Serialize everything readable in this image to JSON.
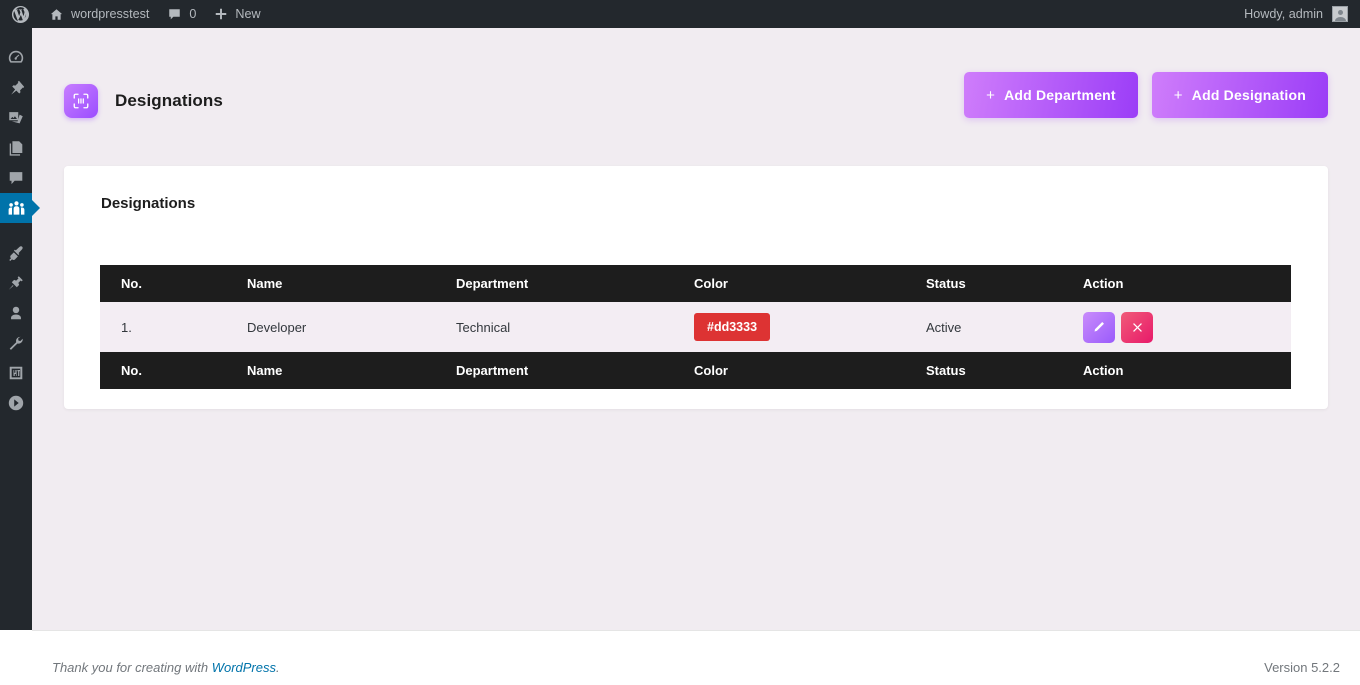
{
  "adminbar": {
    "logo_icon": "wordpress-logo-icon",
    "site_name": "wordpresstest",
    "home_icon": "home-icon",
    "comments_icon": "comment-bubble-icon",
    "comment_count": "0",
    "new_icon": "plus-icon",
    "new_label": "New",
    "howdy": "Howdy, admin",
    "avatar_icon": "avatar-icon"
  },
  "sidebar": {
    "items": [
      {
        "icon": "dashboard-gauge-icon",
        "active": false
      },
      {
        "icon": "pin-posts-icon",
        "active": false
      },
      {
        "icon": "media-photo-icon",
        "active": false
      },
      {
        "icon": "pages-document-icon",
        "active": false
      },
      {
        "icon": "comments-bubble-icon",
        "active": false
      },
      {
        "icon": "group-people-icon",
        "active": true
      },
      {
        "icon": "appearance-brush-icon",
        "active": false
      },
      {
        "icon": "plugins-plug-icon",
        "active": false
      },
      {
        "icon": "users-person-icon",
        "active": false
      },
      {
        "icon": "tools-wrench-icon",
        "active": false
      },
      {
        "icon": "settings-sliders-icon",
        "active": false
      },
      {
        "icon": "collapse-arrow-icon",
        "active": false
      }
    ]
  },
  "page": {
    "icon": "designation-badge-icon",
    "title": "Designations",
    "buttons": [
      {
        "icon": "plus-icon",
        "label": "Add Department"
      },
      {
        "icon": "plus-icon",
        "label": "Add Designation"
      }
    ]
  },
  "card": {
    "title": "Designations",
    "columns": [
      "No.",
      "Name",
      "Department",
      "Color",
      "Status",
      "Action"
    ],
    "rows": [
      {
        "no": "1.",
        "name": "Developer",
        "department": "Technical",
        "color": "#dd3333",
        "color_label": "#dd3333",
        "status": "Active",
        "edit_icon": "pencil-edit-icon",
        "delete_icon": "close-x-icon"
      }
    ],
    "footer_columns": [
      "No.",
      "Name",
      "Department",
      "Color",
      "Status",
      "Action"
    ]
  },
  "footer": {
    "thanks_prefix": "Thank you for creating with ",
    "wordpress_link": "WordPress",
    "thanks_suffix": ".",
    "version": "Version 5.2.2"
  },
  "colors": {
    "adminbar": "#23282d",
    "accent_blue": "#0073aa",
    "page_bg": "#f1ecf1",
    "table_header": "#1d1d1d",
    "row_bg": "#f3edf3",
    "purple_start": "#cf7dfb",
    "purple_end": "#9b3df7"
  }
}
